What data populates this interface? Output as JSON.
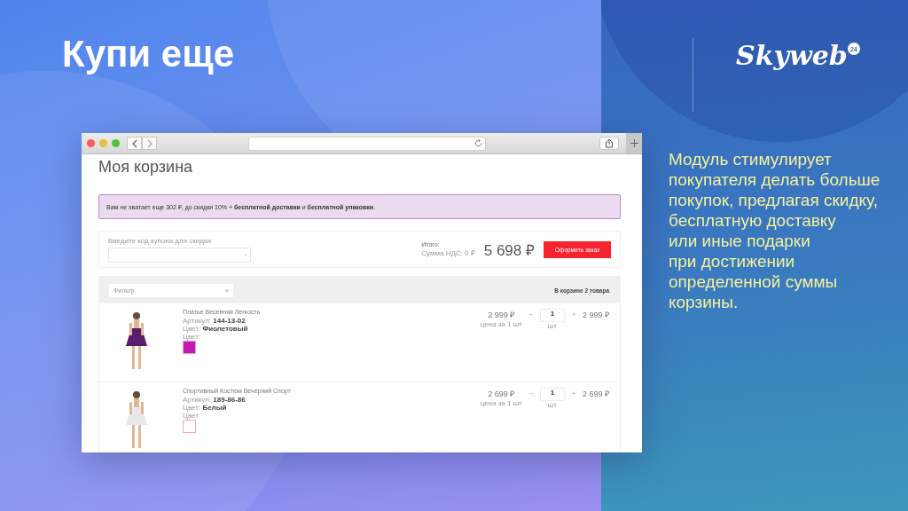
{
  "slide": {
    "title": "Купи еще",
    "logo": {
      "text": "Skyweb",
      "badge": "24"
    },
    "description": "Модуль стимулирует\nпокупателя делать больше\nпокупок, предлагая скидку,\nбесплатную доставку\nили иные подарки\nпри достижении\nопределенной суммы\nкорзины."
  },
  "browser": {
    "page_title": "Моя корзина",
    "notice": "Вам не хватает еще 302 ₽, до скидки 10% + **бесплатной доставки** и **бесплатной упаковки**.",
    "coupon": {
      "label": "Введите код купона для скидки",
      "arrow": "›"
    },
    "total": {
      "label": "Итого:",
      "vat": "Сумма НДС: 0 ₽",
      "amount": "5 698 ₽",
      "button": "Оформить заказ"
    },
    "filter": {
      "placeholder": "Фильтр",
      "clear": "×"
    },
    "count": "В корзине 2 товара",
    "items": [
      {
        "name": "Платье Весенняя Легкость",
        "article_label": "Артикул:",
        "article": "144-13-02",
        "color_label": "Цвет:",
        "color_name": "Фиолетовый",
        "swatch_label": "Цвет:",
        "color": "#c21bb5",
        "price": "2 999 ₽",
        "price_note": "цена за 1 шт",
        "minus": "−",
        "qty": "1",
        "unit": "шт",
        "plus": "+",
        "sum": "2 999 ₽"
      },
      {
        "name": "Спортивный Костюм Вечерний Спорт",
        "article_label": "Артикул:",
        "article": "189-86-86",
        "color_label": "Цвет:",
        "color_name": "Белый",
        "swatch_label": "Цвет:",
        "color": "#ffffff",
        "price": "2 699 ₽",
        "price_note": "цена за 1 шт",
        "minus": "−",
        "qty": "1",
        "unit": "шт",
        "plus": "+",
        "sum": "2 699 ₽"
      }
    ]
  }
}
